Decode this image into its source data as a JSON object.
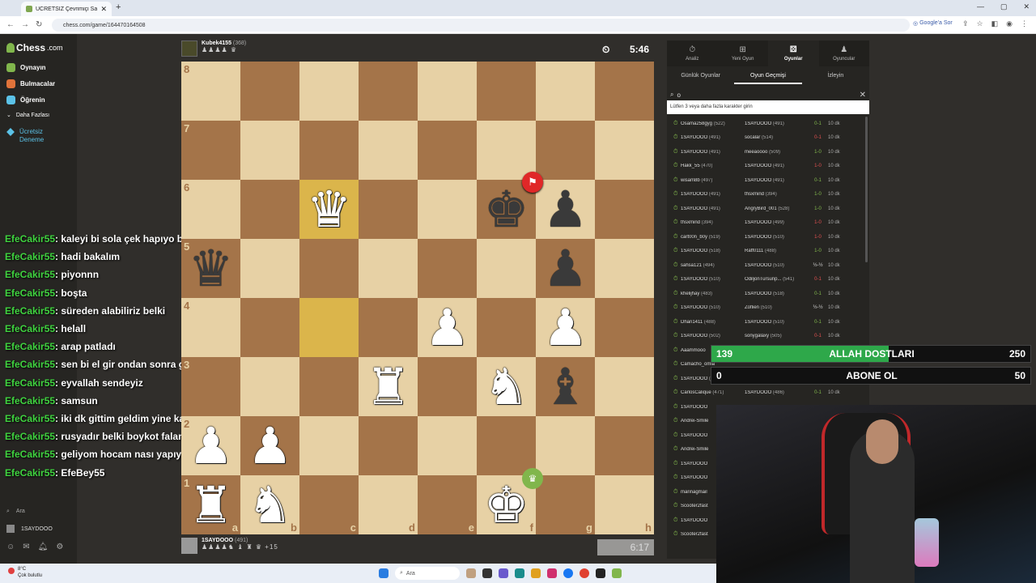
{
  "browser": {
    "tab_title": "ÜCRETSİZ Çevrimiçi Satranç Oy",
    "url": "chess.com/game/164470164508",
    "google_label": "Google'a Sor"
  },
  "sidebar": {
    "logo": "Chess",
    "logo_suffix": ".com",
    "items": [
      {
        "label": "Oynayın",
        "color": "#81b64c"
      },
      {
        "label": "Bulmacalar",
        "color": "#e0733a"
      },
      {
        "label": "Öğrenin",
        "color": "#5bc2e7"
      },
      {
        "label": "Daha Fazlası",
        "color": "#888888"
      }
    ],
    "premium": [
      "Ücretsiz",
      "Deneme"
    ],
    "search": "Ara",
    "username": "1SAYDOOO"
  },
  "chat": [
    {
      "user": "EfeCakir55",
      "msg": ": kaleyi bi sola çek hapıyo bakalım"
    },
    {
      "user": "EfeCakir55",
      "msg": ": hadi bakalım"
    },
    {
      "user": "EfeCakir55",
      "msg": ": piyonnn"
    },
    {
      "user": "EfeCakir55",
      "msg": ": boşta"
    },
    {
      "user": "EfeCakir55",
      "msg": ": süreden alabiliriz belki"
    },
    {
      "user": "EfeCakir55",
      "msg": ": helall"
    },
    {
      "user": "EfeCakir55",
      "msg": ": arap patladı"
    },
    {
      "user": "EfeCakir55",
      "msg": ": sen bi el gir ondan sonra gelim hocam bişeler yiyorum şuan"
    },
    {
      "user": "EfeCakir55",
      "msg": ": eyvallah sendeyiz"
    },
    {
      "user": "EfeCakir55",
      "msg": ": samsun"
    },
    {
      "user": "EfeCakir55",
      "msg": ": iki dk gittim geldim yine kazanıyon reis"
    },
    {
      "user": "EfeCakir55",
      "msg": ": rusyadır belki boykot falan ayağına göstermiyolardı bi ara"
    },
    {
      "user": "EfeCakir55",
      "msg": ": geliyom hocam nası yapıyoz"
    },
    {
      "user": "EfeCakir55",
      "msg": ": EfeBey55"
    }
  ],
  "top_player": {
    "name": "Kubek4155",
    "rating": "(368)",
    "captured": "♟♟♟♟ ♛",
    "clock": "5:46",
    "clock_icon": "⏲"
  },
  "bottom_player": {
    "name": "1SAYDOOO",
    "rating": "(491)",
    "captured": "♟♟♟♟♞ ♝ ♜ ♛",
    "advantage": "+15",
    "clock": "6:17"
  },
  "board": {
    "ranks": [
      "8",
      "7",
      "6",
      "5",
      "4",
      "3",
      "2",
      "1"
    ],
    "files": [
      "a",
      "b",
      "c",
      "d",
      "e",
      "f",
      "g",
      "h"
    ],
    "pieces": [
      [
        "",
        "",
        "",
        "",
        "",
        "",
        "",
        ""
      ],
      [
        "",
        "",
        "",
        "",
        "",
        "",
        "",
        ""
      ],
      [
        "",
        "",
        "♛",
        "",
        "",
        "♚",
        "♟",
        ""
      ],
      [
        "♛",
        "",
        "",
        "",
        "",
        "",
        "♟",
        ""
      ],
      [
        "",
        "",
        "",
        "",
        "♟",
        "",
        "♟",
        ""
      ],
      [
        "",
        "",
        "",
        "♜",
        "",
        "♞",
        "♝",
        ""
      ],
      [
        "♟",
        "♟",
        "",
        "",
        "",
        "",
        "",
        ""
      ],
      [
        "♜",
        "♞",
        "",
        "",
        "",
        "♚",
        "",
        ""
      ]
    ],
    "colors": [
      [
        "",
        "",
        "",
        "",
        "",
        "",
        "",
        ""
      ],
      [
        "",
        "",
        "",
        "",
        "",
        "",
        "",
        ""
      ],
      [
        "",
        "",
        "w",
        "",
        "",
        "b",
        "b",
        ""
      ],
      [
        "b",
        "",
        "",
        "",
        "",
        "",
        "b",
        ""
      ],
      [
        "",
        "",
        "",
        "",
        "w",
        "",
        "w",
        ""
      ],
      [
        "",
        "",
        "",
        "w",
        "",
        "w",
        "b",
        ""
      ],
      [
        "w",
        "w",
        "",
        "",
        "",
        "",
        "",
        ""
      ],
      [
        "w",
        "w",
        "",
        "",
        "",
        "w",
        "",
        ""
      ]
    ],
    "highlight": [
      [
        2,
        2
      ],
      [
        4,
        2
      ]
    ],
    "flag_icon": "⚑",
    "crown_icon": "♛"
  },
  "panel": {
    "tabs": [
      {
        "icon": "⏱",
        "label": "Analiz"
      },
      {
        "icon": "⊞",
        "label": "Yeni Oyun"
      },
      {
        "icon": "⚄",
        "label": "Oyunlar"
      },
      {
        "icon": "♟",
        "label": "Oyuncular"
      }
    ],
    "subtabs": [
      "Günlük Oyunlar",
      "Oyun Geçmişi",
      "İzleyin"
    ],
    "search_value": "o",
    "tooltip": "Lütfen 3 veya daha fazla karakter girin",
    "games": [
      {
        "w": "Osama258gyg",
        "wr": "(522)",
        "b": "1SAYDOOO",
        "br": "(491)",
        "res": "0-1",
        "win": true,
        "tc": "10 dk"
      },
      {
        "w": "1SAYDOOO",
        "wr": "(491)",
        "b": "socalar",
        "br": "(514)",
        "res": "0-1",
        "win": false,
        "tc": "10 dk"
      },
      {
        "w": "1SAYDOOO",
        "wr": "(491)",
        "b": "meeaoooo",
        "br": "(509)",
        "res": "1-0",
        "win": true,
        "tc": "10 dk"
      },
      {
        "w": "Hakk_55",
        "wr": "(470)",
        "b": "1SAYDOOO",
        "br": "(491)",
        "res": "1-0",
        "win": false,
        "tc": "10 dk"
      },
      {
        "w": "wisam8b",
        "wr": "(497)",
        "b": "1SAYDOOO",
        "br": "(491)",
        "res": "0-1",
        "win": true,
        "tc": "10 dk"
      },
      {
        "w": "1SAYDOOO",
        "wr": "(491)",
        "b": "thsxmind",
        "br": "(394)",
        "res": "1-0",
        "win": true,
        "tc": "10 dk"
      },
      {
        "w": "1SAYDOOO",
        "wr": "(491)",
        "b": "AngryBird_001",
        "br": "(528)",
        "res": "1-0",
        "win": true,
        "tc": "10 dk"
      },
      {
        "w": "thsxmind",
        "wr": "(394)",
        "b": "1SAYDOOO",
        "br": "(499)",
        "res": "1-0",
        "win": false,
        "tc": "10 dk"
      },
      {
        "w": "cart00n_b0y",
        "wr": "(519)",
        "b": "1SAYDOOO",
        "br": "(510)",
        "res": "1-0",
        "win": false,
        "tc": "10 dk"
      },
      {
        "w": "1SAYDOOO",
        "wr": "(518)",
        "b": "Raff0111",
        "br": "(488)",
        "res": "1-0",
        "win": true,
        "tc": "10 dk"
      },
      {
        "w": "sahsa121",
        "wr": "(494)",
        "b": "1SAYDOOO",
        "br": "(510)",
        "res": "½-½",
        "win": null,
        "tc": "10 dk"
      },
      {
        "w": "1SAYDOOO",
        "wr": "(510)",
        "b": "OdiljonTursunp...",
        "br": "(541)",
        "res": "0-1",
        "win": false,
        "tc": "10 dk"
      },
      {
        "w": "khelijhay",
        "wr": "(483)",
        "b": "1SAYDOOO",
        "br": "(518)",
        "res": "0-1",
        "win": true,
        "tc": "10 dk"
      },
      {
        "w": "1SAYDOOO",
        "wr": "(510)",
        "b": "Zoflien",
        "br": "(510)",
        "res": "½-½",
        "win": null,
        "tc": "10 dk"
      },
      {
        "w": "Dhan1411",
        "wr": "(488)",
        "b": "1SAYDOOO",
        "br": "(510)",
        "res": "0-1",
        "win": true,
        "tc": "10 dk"
      },
      {
        "w": "1SAYDOOO",
        "wr": "(502)",
        "b": "sonygalaxy",
        "br": "(505)",
        "res": "0-1",
        "win": false,
        "tc": "10 dk"
      },
      {
        "w": "Aaammooo",
        "wr": "",
        "b": "",
        "br": "",
        "res": "",
        "win": null,
        "tc": ""
      },
      {
        "w": "Camacho_omla",
        "wr": "",
        "b": "",
        "br": "",
        "res": "",
        "win": null,
        "tc": ""
      },
      {
        "w": "1SAYDOOO",
        "wr": "(",
        "b": "ozageeeee",
        "br": "(509)",
        "res": "0-1",
        "win": false,
        "tc": "10 dk"
      },
      {
        "w": "CarlosCalique",
        "wr": "(471)",
        "b": "1SAYDOOO",
        "br": "(486)",
        "res": "0-1",
        "win": true,
        "tc": "10 dk"
      },
      {
        "w": "1SAYDOOO",
        "wr": "",
        "b": "",
        "br": "",
        "res": "",
        "win": null,
        "tc": ""
      },
      {
        "w": "Andrei-Smile",
        "wr": "",
        "b": "",
        "br": "",
        "res": "",
        "win": null,
        "tc": ""
      },
      {
        "w": "1SAYDOOO",
        "wr": "",
        "b": "",
        "br": "",
        "res": "",
        "win": null,
        "tc": ""
      },
      {
        "w": "Andrei-Smile",
        "wr": "",
        "b": "",
        "br": "",
        "res": "",
        "win": null,
        "tc": ""
      },
      {
        "w": "1SAYDOOO",
        "wr": "",
        "b": "",
        "br": "",
        "res": "",
        "win": null,
        "tc": ""
      },
      {
        "w": "1SAYDOOO",
        "wr": "",
        "b": "",
        "br": "",
        "res": "",
        "win": null,
        "tc": ""
      },
      {
        "w": "marinagmail",
        "wr": "",
        "b": "",
        "br": "",
        "res": "",
        "win": null,
        "tc": ""
      },
      {
        "w": "Scooter2fast",
        "wr": "",
        "b": "",
        "br": "",
        "res": "",
        "win": null,
        "tc": ""
      },
      {
        "w": "1SAYDOOO",
        "wr": "",
        "b": "",
        "br": "",
        "res": "",
        "win": null,
        "tc": ""
      },
      {
        "w": "Scooter2fast",
        "wr": "",
        "b": "",
        "br": "",
        "res": "",
        "win": null,
        "tc": ""
      }
    ]
  },
  "goals": [
    {
      "current": "139",
      "label": "ALLAH DOSTLARI",
      "target": "250",
      "fill": 0.556
    },
    {
      "current": "0",
      "label": "ABONE OL",
      "target": "50",
      "fill": 0
    }
  ],
  "taskbar": {
    "temp": "8°C",
    "weather": "Çok bulutlu",
    "search": "Ara"
  }
}
